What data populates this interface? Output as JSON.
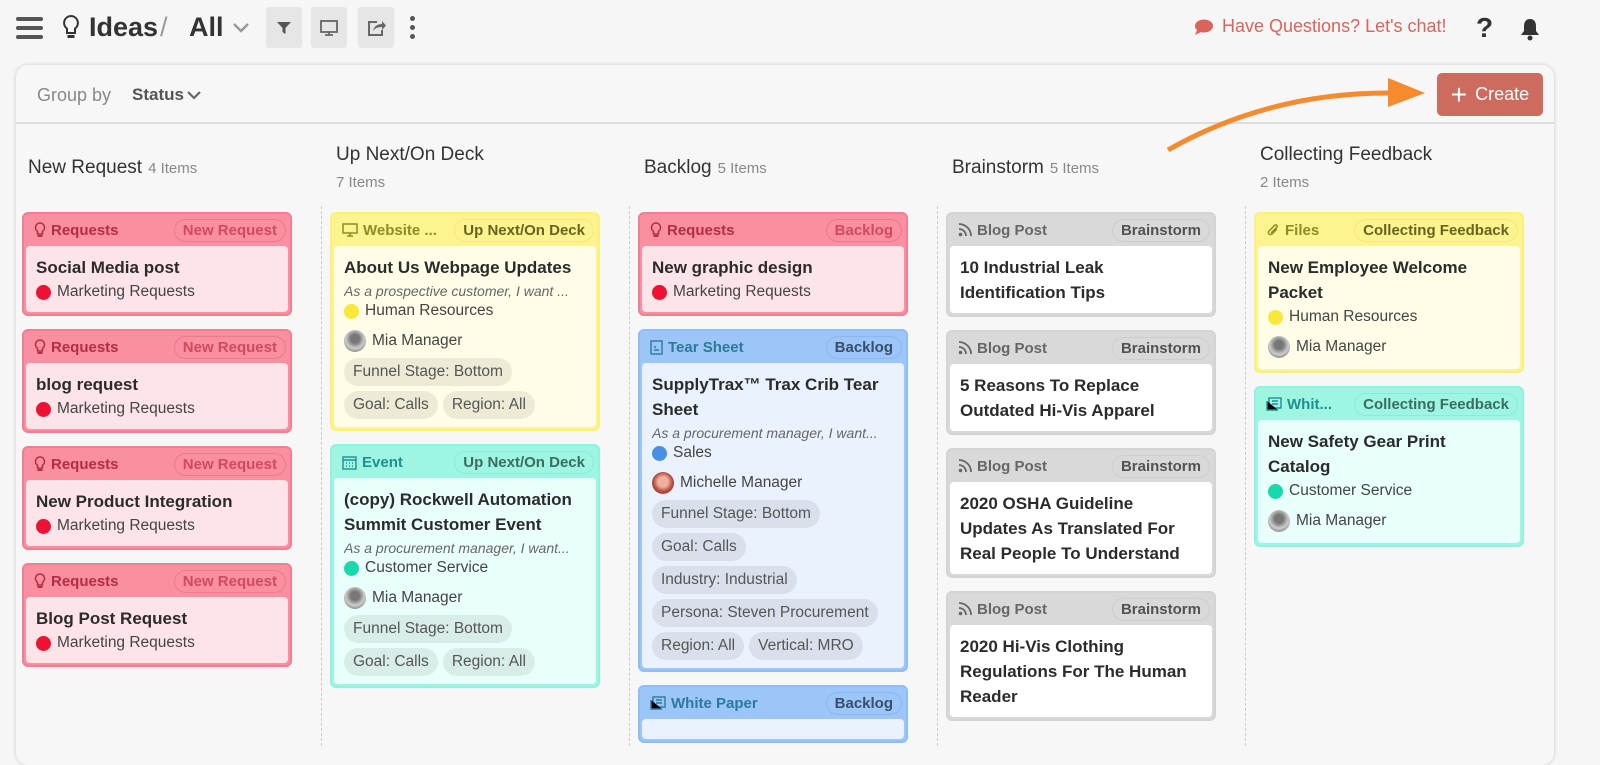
{
  "header": {
    "module": "Ideas",
    "separator": "/",
    "view": "All",
    "chat_label": "Have Questions? Let's chat!",
    "help": "?"
  },
  "toolbar": {
    "group_by_label": "Group by",
    "group_by_value": "Status",
    "create_label": "Create"
  },
  "colors": {
    "accent": "#cd6b5e",
    "chat": "#d8645a",
    "arrow": "#f58a2e"
  },
  "columns": [
    {
      "name": "New Request",
      "count": "4 Items",
      "layout": "one",
      "cards": [
        {
          "theme": "red",
          "icon": "bulb",
          "type": "Requests",
          "status": "New Request",
          "title": "Social Media post",
          "dept": "Marketing Requests",
          "dept_color": "#ee1133"
        },
        {
          "theme": "red",
          "icon": "bulb",
          "type": "Requests",
          "status": "New Request",
          "title": "blog request",
          "dept": "Marketing Requests",
          "dept_color": "#ee1133"
        },
        {
          "theme": "red",
          "icon": "bulb",
          "type": "Requests",
          "status": "New Request",
          "title": "New Product Integration",
          "dept": "Marketing Requests",
          "dept_color": "#ee1133"
        },
        {
          "theme": "red",
          "icon": "bulb",
          "type": "Requests",
          "status": "New Request",
          "title": "Blog Post Request",
          "dept": "Marketing Requests",
          "dept_color": "#ee1133"
        }
      ]
    },
    {
      "name": "Up Next/On Deck",
      "count": "7 Items",
      "layout": "two",
      "cards": [
        {
          "theme": "yellow",
          "icon": "monitor",
          "type": "Website ...",
          "status": "Up Next/On Deck",
          "title": "About Us Webpage Updates",
          "desc": "As a prospective customer, I want ...",
          "dept": "Human Resources",
          "dept_color": "#f7e83a",
          "owner": "Mia Manager",
          "tags": [
            "Funnel Stage: Bottom",
            "Goal: Calls",
            "Region: All"
          ]
        },
        {
          "theme": "teal",
          "icon": "calendar",
          "type": "Event",
          "status": "Up Next/On Deck",
          "title": "(copy) Rockwell Automation Summit Customer Event",
          "desc": "As a procurement manager, I want...",
          "dept": "Customer Service",
          "dept_color": "#19d9ac",
          "owner": "Mia Manager",
          "tags": [
            "Funnel Stage: Bottom",
            "Goal: Calls",
            "Region: All"
          ]
        }
      ]
    },
    {
      "name": "Backlog",
      "count": "5 Items",
      "layout": "one",
      "cards": [
        {
          "theme": "red",
          "icon": "bulb",
          "type": "Requests",
          "status": "Backlog",
          "title": "New graphic design",
          "dept": "Marketing Requests",
          "dept_color": "#ee1133"
        },
        {
          "theme": "blue",
          "icon": "doc",
          "type": "Tear Sheet",
          "status": "Backlog",
          "title": "SupplyTrax™ Trax Crib Tear Sheet",
          "desc": "As a procurement manager, I want...",
          "dept": "Sales",
          "dept_color": "#4a90e2",
          "owner": "Michelle Manager",
          "owner_color": "#b0463a",
          "tags": [
            "Funnel Stage: Bottom",
            "Goal: Calls",
            "Industry: Industrial",
            "Persona: Steven Procurement",
            "Region: All",
            "Vertical: MRO"
          ]
        },
        {
          "theme": "blue",
          "icon": "paper",
          "type": "White Paper",
          "status": "Backlog",
          "title": ""
        }
      ]
    },
    {
      "name": "Brainstorm",
      "count": "5 Items",
      "layout": "one",
      "cards": [
        {
          "theme": "gray",
          "icon": "rss",
          "type": "Blog Post",
          "status": "Brainstorm",
          "title": "10 Industrial Leak Identification Tips"
        },
        {
          "theme": "gray",
          "icon": "rss",
          "type": "Blog Post",
          "status": "Brainstorm",
          "title": "5 Reasons To Replace Outdated Hi-Vis Apparel"
        },
        {
          "theme": "gray",
          "icon": "rss",
          "type": "Blog Post",
          "status": "Brainstorm",
          "title": "2020 OSHA Guideline Updates As Translated For Real People To Understand"
        },
        {
          "theme": "gray",
          "icon": "rss",
          "type": "Blog Post",
          "status": "Brainstorm",
          "title": "2020 Hi-Vis Clothing Regulations For The Human Reader"
        }
      ]
    },
    {
      "name": "Collecting Feedback",
      "count": "2 Items",
      "layout": "two",
      "cards": [
        {
          "theme": "yellow",
          "icon": "paperclip",
          "type": "Files",
          "status": "Collecting Feedback",
          "title": "New Employee Welcome Packet",
          "dept": "Human Resources",
          "dept_color": "#f7e83a",
          "owner": "Mia Manager"
        },
        {
          "theme": "teal",
          "icon": "paper",
          "type": "Whit...",
          "status": "Collecting Feedback",
          "title": "New Safety Gear Print Catalog",
          "dept": "Customer Service",
          "dept_color": "#19d9ac",
          "owner": "Mia Manager"
        }
      ]
    }
  ]
}
